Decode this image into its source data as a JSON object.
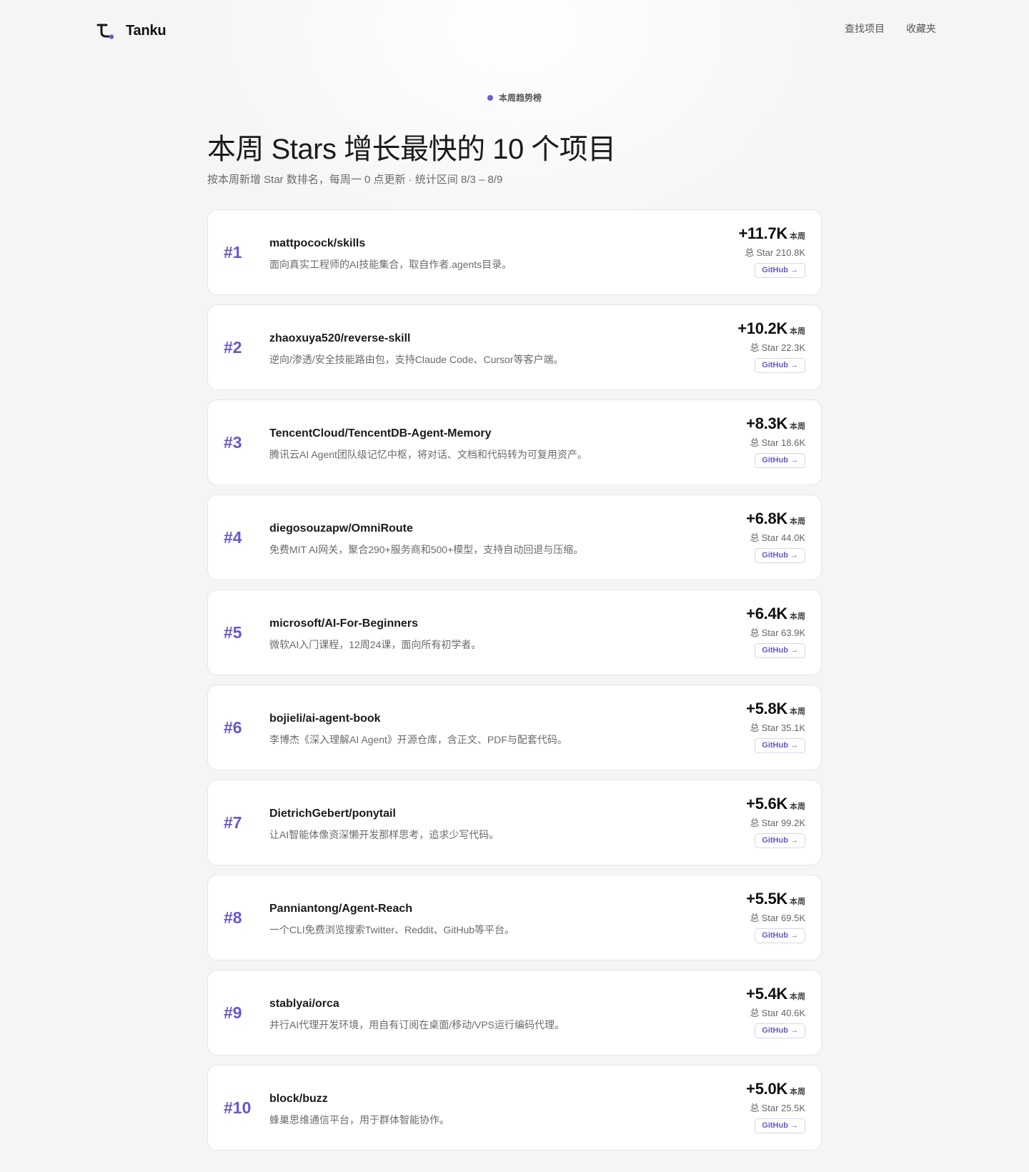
{
  "brand": {
    "name": "Tanku",
    "logo_icon": "tanku-logo-icon"
  },
  "nav": [
    {
      "label": "查找项目"
    },
    {
      "label": "收藏夹"
    }
  ],
  "hero": {
    "kicker": "本周趋势榜",
    "title": "本周 Stars 增长最快的 10 个项目",
    "subtitle": "按本周新增 Star 数排名，每周一 0 点更新 · 统计区间 8/3 – 8/9"
  },
  "colors": {
    "accent": "#6a57c8",
    "background": "#f5f5f5",
    "card": "#ffffff"
  },
  "projects": [
    {
      "rank": "#1",
      "name": "mattpocock/skills",
      "description": "面向真实工程师的AI技能集合，取自作者.agents目录。",
      "growth": "+11.7K",
      "growth_unit": "本周",
      "total_icon": "总",
      "total": "Star 210.8K",
      "button": "GitHub →"
    },
    {
      "rank": "#2",
      "name": "zhaoxuya520/reverse-skill",
      "description": "逆向/渗透/安全技能路由包，支持Claude Code、Cursor等客户端。",
      "growth": "+10.2K",
      "growth_unit": "本周",
      "total_icon": "总",
      "total": "Star 22.3K",
      "button": "GitHub →"
    },
    {
      "rank": "#3",
      "name": "TencentCloud/TencentDB-Agent-Memory",
      "description": "腾讯云AI Agent团队级记忆中枢，将对话、文档和代码转为可复用资产。",
      "growth": "+8.3K",
      "growth_unit": "本周",
      "total_icon": "总",
      "total": "Star 18.6K",
      "button": "GitHub →"
    },
    {
      "rank": "#4",
      "name": "diegosouzapw/OmniRoute",
      "description": "免费MIT AI网关，聚合290+服务商和500+模型，支持自动回退与压缩。",
      "growth": "+6.8K",
      "growth_unit": "本周",
      "total_icon": "总",
      "total": "Star 44.0K",
      "button": "GitHub →"
    },
    {
      "rank": "#5",
      "name": "microsoft/AI-For-Beginners",
      "description": "微软AI入门课程，12周24课，面向所有初学者。",
      "growth": "+6.4K",
      "growth_unit": "本周",
      "total_icon": "总",
      "total": "Star 63.9K",
      "button": "GitHub →"
    },
    {
      "rank": "#6",
      "name": "bojieli/ai-agent-book",
      "description": "李博杰《深入理解AI Agent》开源仓库，含正文、PDF与配套代码。",
      "growth": "+5.8K",
      "growth_unit": "本周",
      "total_icon": "总",
      "total": "Star 35.1K",
      "button": "GitHub →"
    },
    {
      "rank": "#7",
      "name": "DietrichGebert/ponytail",
      "description": "让AI智能体像资深懒开发那样思考，追求少写代码。",
      "growth": "+5.6K",
      "growth_unit": "本周",
      "total_icon": "总",
      "total": "Star 99.2K",
      "button": "GitHub →"
    },
    {
      "rank": "#8",
      "name": "Panniantong/Agent-Reach",
      "description": "一个CLI免费浏览搜索Twitter、Reddit、GitHub等平台。",
      "growth": "+5.5K",
      "growth_unit": "本周",
      "total_icon": "总",
      "total": "Star 69.5K",
      "button": "GitHub →"
    },
    {
      "rank": "#9",
      "name": "stablyai/orca",
      "description": "并行AI代理开发环境，用自有订阅在桌面/移动/VPS运行编码代理。",
      "growth": "+5.4K",
      "growth_unit": "本周",
      "total_icon": "总",
      "total": "Star 40.6K",
      "button": "GitHub →"
    },
    {
      "rank": "#10",
      "name": "block/buzz",
      "description": "蜂巢思维通信平台，用于群体智能协作。",
      "growth": "+5.0K",
      "growth_unit": "本周",
      "total_icon": "总",
      "total": "Star 25.5K",
      "button": "GitHub →"
    }
  ]
}
